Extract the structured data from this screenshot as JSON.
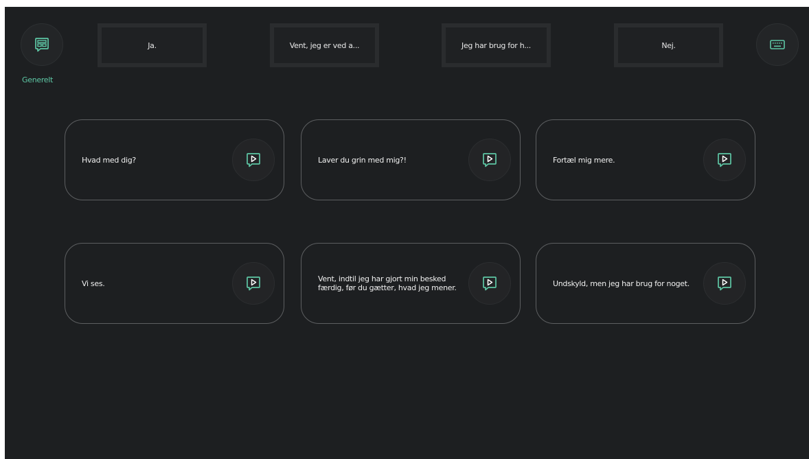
{
  "header": {
    "category_label": "Generelt",
    "category_icon": "phrase-board-icon",
    "keyboard_icon": "keyboard-icon",
    "quick_replies": [
      {
        "label": "Ja."
      },
      {
        "label": "Vent, jeg er ved a..."
      },
      {
        "label": "Jeg har brug for h..."
      },
      {
        "label": "Nej."
      }
    ]
  },
  "phrases": [
    {
      "text": "Hvad med dig?"
    },
    {
      "text": "Laver du grin med mig?!"
    },
    {
      "text": "Fortæl mig mere."
    },
    {
      "text": "Vi ses."
    },
    {
      "text": "Vent, indtil jeg har gjort min besked færdig, før du gætter, hvad jeg mener."
    },
    {
      "text": "Undskyld, men jeg har brug for noget."
    }
  ],
  "phrase_action_icon": "speech-play-icon",
  "colors": {
    "background": "#1d1f21",
    "accent": "#5ec7a5",
    "text": "#f0f0f0",
    "card_border": "#5d5f61"
  }
}
